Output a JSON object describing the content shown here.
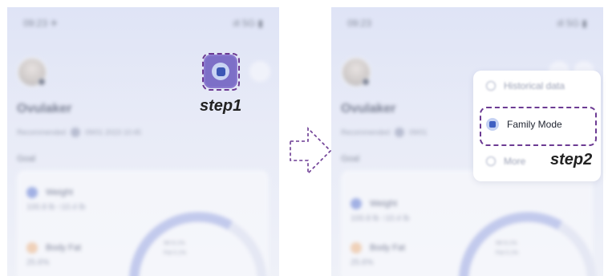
{
  "left_screen": {
    "statusbar": {
      "time": "09:23 ✈",
      "signals": "ıll 5G ▮"
    },
    "username": "Ovulaker",
    "meta": {
      "recommend": "Recommended",
      "date": "09/01 2023 10:45"
    },
    "section_label": "Goal",
    "metrics": [
      {
        "label": "Weight",
        "value": "100.8 lb ↑10.4 lb"
      },
      {
        "label": "Body Fat",
        "value": "25.6%"
      }
    ],
    "legend": [
      "Wt 8.1%",
      "Fat 0.1%"
    ]
  },
  "right_screen": {
    "statusbar": {
      "time": "09:23",
      "signals": "ıll 5G ▮"
    },
    "username": "Ovulaker",
    "meta": {
      "recommend": "Recommended",
      "date": "09/01"
    },
    "section_label": "Goal",
    "metrics": [
      {
        "label": "Weight",
        "value": "100.8 lb ↑10.4 lb"
      },
      {
        "label": "Body Fat",
        "value": "25.6%"
      }
    ],
    "legend": [
      "Wt 8.1%",
      "Fat 0.1%"
    ],
    "menu": {
      "items": [
        {
          "label": "Historical data",
          "icon": "clock-icon"
        },
        {
          "label": "Family Mode",
          "icon": "family-mode-icon"
        },
        {
          "label": "More",
          "icon": "info-icon"
        }
      ]
    }
  },
  "annotations": {
    "step1": "step1",
    "step2": "step2"
  },
  "colors": {
    "dash_border": "#6c3b93",
    "icon_purple": "#7d6fc7",
    "icon_blue": "#3f5fc2",
    "gauge_arc": "#b7c0ea"
  }
}
